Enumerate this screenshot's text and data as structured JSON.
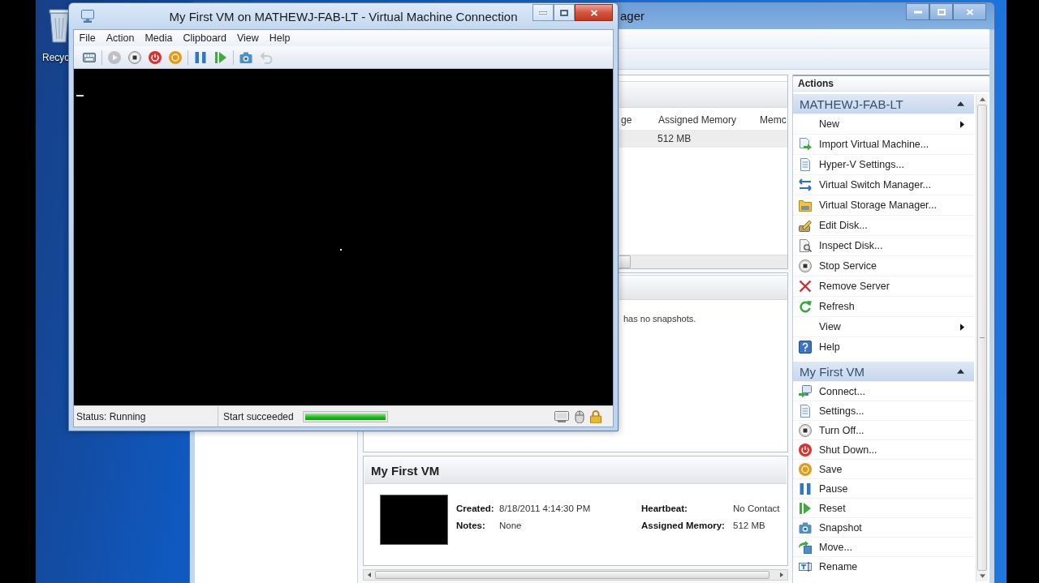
{
  "vm_window": {
    "title": "My First VM on MATHEWJ-FAB-LT - Virtual Machine Connection",
    "menu": [
      "File",
      "Action",
      "Media",
      "Clipboard",
      "View",
      "Help"
    ],
    "toolbar": [
      {
        "buttons": [
          {
            "kind": "ctrlaltdel",
            "disabled": false
          }
        ]
      },
      {
        "buttons": [
          {
            "kind": "start",
            "disabled": true
          },
          {
            "kind": "turnoff",
            "disabled": false
          },
          {
            "kind": "shutdown",
            "disabled": false
          },
          {
            "kind": "save",
            "disabled": false
          }
        ]
      },
      {
        "buttons": [
          {
            "kind": "pause",
            "disabled": false
          },
          {
            "kind": "reset",
            "disabled": false
          }
        ]
      },
      {
        "buttons": [
          {
            "kind": "snapshot",
            "disabled": false
          },
          {
            "kind": "revert",
            "disabled": true
          }
        ]
      }
    ],
    "status": "Status: Running",
    "message": "Start succeeded",
    "progress": {
      "level": 1
    }
  },
  "desktop": {
    "icons": [
      {
        "label": "Recyc"
      }
    ]
  },
  "manager_window": {
    "title": "ager",
    "vm_list": {
      "columns": [
        "ge",
        "Assigned Memory",
        "Memc"
      ],
      "rows": [
        {
          "assigned_memory": "512 MB",
          "selected": true
        }
      ]
    },
    "snapshots": {
      "message": "has no snapshots."
    },
    "details": {
      "title": "My First VM",
      "fields": [
        {
          "label": "Created:",
          "value": "8/18/2011 4:14:30 PM"
        },
        {
          "label": "Heartbeat:",
          "value": "No Contact"
        },
        {
          "label": "Notes:",
          "value": "None"
        },
        {
          "label": "Assigned Memory:",
          "value": "512 MB"
        }
      ]
    },
    "actions": {
      "title": "Actions",
      "groups": [
        {
          "title": "MATHEWJ-FAB-LT",
          "expanded": true,
          "items": [
            {
              "label": "New",
              "kind": "submenu"
            },
            {
              "label": "Import Virtual Machine...",
              "kind": "import"
            },
            {
              "label": "Hyper-V Settings...",
              "kind": "settings"
            },
            {
              "label": "Virtual Switch Manager...",
              "kind": "switch"
            },
            {
              "label": "Virtual Storage Manager...",
              "kind": "storage"
            },
            {
              "label": "Edit Disk...",
              "kind": "edit"
            },
            {
              "label": "Inspect Disk...",
              "kind": "inspect"
            },
            {
              "label": "Stop Service",
              "kind": "stop"
            },
            {
              "label": "Remove Server",
              "kind": "remove"
            },
            {
              "label": "Refresh",
              "kind": "refresh"
            },
            {
              "label": "View",
              "kind": "submenu"
            },
            {
              "label": "Help",
              "kind": "help"
            }
          ]
        },
        {
          "title": "My First VM",
          "expanded": true,
          "items": [
            {
              "label": "Connect...",
              "kind": "connect"
            },
            {
              "label": "Settings...",
              "kind": "settings"
            },
            {
              "label": "Turn Off...",
              "kind": "turnoff"
            },
            {
              "label": "Shut Down...",
              "kind": "shutdown"
            },
            {
              "label": "Save",
              "kind": "save"
            },
            {
              "label": "Pause",
              "kind": "pause"
            },
            {
              "label": "Reset",
              "kind": "reset"
            },
            {
              "label": "Snapshot",
              "kind": "snapshot"
            },
            {
              "label": "Move...",
              "kind": "move"
            },
            {
              "label": "Rename",
              "kind": "rename"
            }
          ]
        }
      ]
    }
  }
}
